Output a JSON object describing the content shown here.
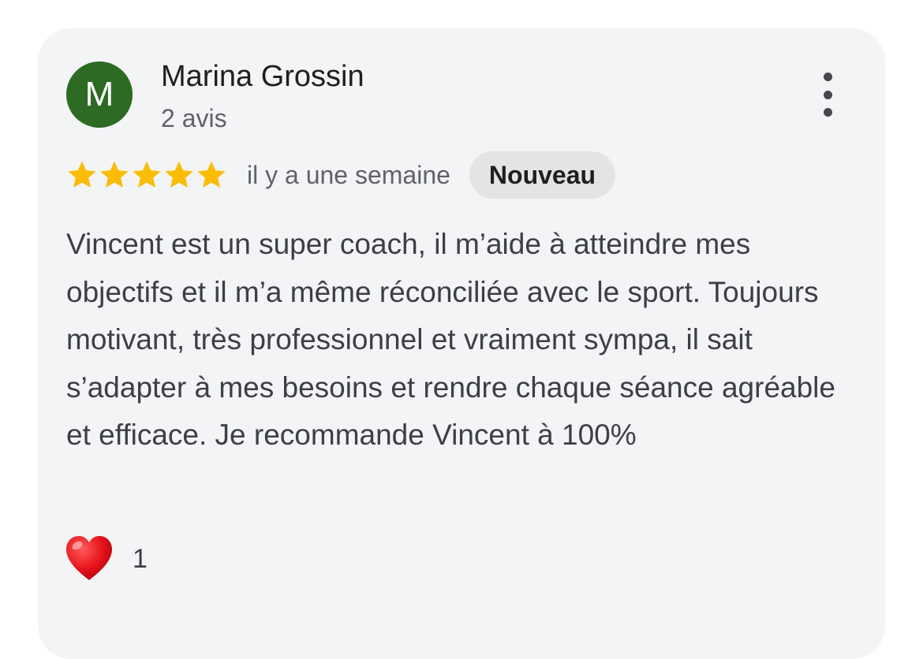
{
  "review": {
    "author": {
      "initial": "M",
      "name": "Marina Grossin",
      "review_count": "2 avis",
      "avatar_color": "#2d6a23"
    },
    "rating": 5,
    "rating_max": 5,
    "star_color": "#fbbc04",
    "date": "il y a une semaine",
    "badge": "Nouveau",
    "text": "Vincent est un super coach, il m’aide à atteindre mes objectifs et il m’a même réconciliée avec le sport. Toujours motivant, très professionnel et vraiment sympa, il sait s’adapter à mes besoins et rendre chaque séance agréable et efficace. Je recommande Vincent à 100%",
    "reaction": {
      "icon": "red-heart-icon",
      "count": "1"
    },
    "menu_icon": "more-vert-icon"
  }
}
